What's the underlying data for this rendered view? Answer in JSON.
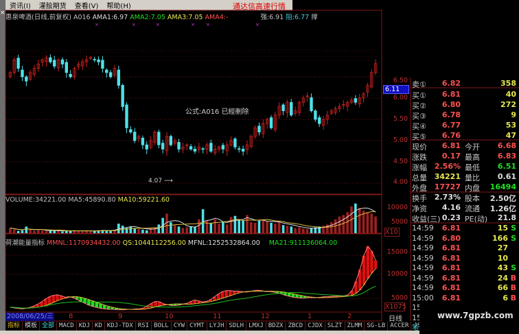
{
  "menu": {
    "items": [
      "资讯(I)",
      "灌脍期货",
      "查看(V)",
      "帮助(H)"
    ],
    "app_title": "通达信高速行情",
    "close_glyph": "×"
  },
  "legend": {
    "stock": "惠泉啤酒(日线,前复权)",
    "formula": "A016",
    "ama1": "AMA1:6.97",
    "ama2": "AMA2:7.05",
    "ama3": "AMA3:7.05",
    "ama4": "AMA4:-",
    "strong": "强:6.91",
    "resist": "阻:6.77",
    "support": "撑"
  },
  "main": {
    "note": "公式:A016 已經刪除",
    "low_mark": "4.07 ⟶",
    "price_tag": "6.11",
    "axis": [
      "6.50",
      "6.00",
      "5.50",
      "5.00",
      "4.50",
      "4.00"
    ]
  },
  "volume": {
    "label": "VOLUME:34221.00",
    "ma5": "MA5:45890.80",
    "ma10": "MA10:59221.60",
    "axis": [
      "10000",
      "5000"
    ],
    "mult": "X10"
  },
  "indicator": {
    "name": "荷潮能量指标",
    "mmnl": "MMNL:1170934432.00",
    "qs": "QS:1044112256.00",
    "mfnl": "MFNL:1252532864.00",
    "ma21": "MA21:911136064.00",
    "axis": [
      "15000",
      "10000",
      "5000"
    ],
    "mult": "X1075"
  },
  "chart_data": {
    "type": "candlestick",
    "price_range": [
      3.8,
      7.2
    ],
    "closes": [
      6.6,
      6.9,
      6.7,
      6.5,
      6.4,
      6.6,
      6.7,
      6.8,
      6.9,
      6.95,
      6.85,
      6.75,
      6.9,
      6.8,
      6.6,
      6.5,
      6.7,
      6.8,
      6.85,
      6.9,
      6.95,
      6.9,
      6.85,
      6.7,
      6.6,
      6.5,
      6.7,
      6.3,
      5.8,
      5.3,
      5.2,
      5.0,
      5.1,
      4.9,
      4.8,
      5.0,
      5.2,
      4.9,
      4.8,
      5.1,
      4.9,
      5.0,
      4.8,
      4.85,
      4.9,
      4.8,
      4.75,
      4.85,
      4.8,
      4.9,
      4.75,
      4.8,
      4.85,
      4.8,
      4.9,
      5.0,
      4.85,
      4.8,
      4.75,
      4.9,
      5.1,
      5.3,
      5.2,
      5.4,
      5.5,
      5.3,
      5.6,
      5.8,
      5.7,
      5.9,
      5.6,
      5.7,
      5.9,
      6.0,
      6.05,
      5.7,
      5.5,
      5.4,
      5.5,
      5.6,
      5.7,
      5.75,
      5.8,
      5.85,
      5.9,
      5.95,
      5.9,
      6.0,
      6.1,
      6.3,
      6.6,
      6.81
    ],
    "volumes": [
      3000,
      2500,
      2000,
      2200,
      3500,
      2400,
      2000,
      2300,
      2100,
      1900,
      2200,
      2000,
      2100,
      1800,
      2000,
      1900,
      2200,
      2000,
      1800,
      2100,
      1900,
      2000,
      2200,
      2300,
      2100,
      2000,
      2400,
      4500,
      3800,
      3000,
      3500,
      2800,
      2600,
      2400,
      2200,
      2900,
      3200,
      4200,
      6500,
      8000,
      5000,
      4000,
      3500,
      3000,
      3200,
      3600,
      3400,
      6000,
      9500,
      5500,
      4800,
      6000,
      4500,
      5000,
      4200,
      6800,
      7200,
      6000,
      5500,
      7500,
      5000,
      4800,
      5500,
      6000,
      5200,
      4800,
      4500,
      5000,
      4000,
      3800,
      3500,
      3000,
      3200,
      2800,
      2600,
      3000,
      3200,
      3500,
      3800,
      4200,
      5000,
      6000,
      7000,
      7500,
      8500,
      10500,
      11500,
      10000,
      9000,
      8500,
      8000,
      7000
    ],
    "mmnl": [
      3000,
      2800,
      2700,
      2600,
      2700,
      2900,
      3200,
      3600,
      4100,
      4700,
      5200,
      5500,
      5600,
      5400,
      5100,
      5200,
      5000,
      4600,
      4200,
      3800,
      3400,
      3100,
      2900,
      2700,
      2600,
      2500,
      2500,
      2400,
      2400,
      2400,
      2500,
      2500,
      2600,
      2600,
      2800,
      3300,
      3800,
      4200,
      4100,
      3700,
      3500,
      3300,
      3300,
      3400,
      3600,
      3800,
      4200,
      4500,
      4300,
      4100,
      4200,
      4600,
      5200,
      5800,
      6300,
      6500,
      6500,
      6400,
      6400,
      6300,
      6200,
      6300,
      6500,
      6600,
      6500,
      6300,
      6300,
      6200,
      6000,
      5800,
      5500,
      5300,
      5100,
      5000,
      4900,
      4900,
      5000,
      5000,
      5000,
      5100,
      5200,
      5200,
      5300,
      5300,
      5400,
      5400,
      5600,
      6500,
      8500,
      11000,
      14000,
      16000,
      15000,
      13000
    ]
  },
  "datebar": {
    "date": "2008/06/25/三",
    "months": [
      "8",
      "9",
      "10",
      "11",
      "12",
      "1",
      "2"
    ],
    "period": "日线"
  },
  "tabs": [
    "指标",
    "模板",
    "全部",
    "MACD",
    "KDJ",
    "KD",
    "KDJ-TDX",
    "RSI",
    "BOLL",
    "CYW",
    "CYMT",
    "LYJH",
    "SDLH",
    "LMXJ",
    "BDZX",
    "ZBCD",
    "CJDX",
    "SLZT",
    "ZLMM",
    "SG-LB",
    "ACCER",
    "JS",
    "MFI"
  ],
  "tab_extra": "笔",
  "quote": {
    "book": [
      {
        "label": "卖①",
        "price": "6.82",
        "vol": "358"
      },
      {
        "label": "买①",
        "price": "6.81",
        "vol": "40"
      },
      {
        "label": "买②",
        "price": "6.80",
        "vol": "272"
      },
      {
        "label": "买③",
        "price": "6.78",
        "vol": "9"
      },
      {
        "label": "买④",
        "price": "6.77",
        "vol": "53"
      },
      {
        "label": "买⑤",
        "price": "6.76",
        "vol": "47"
      }
    ],
    "stats": [
      {
        "l": "现价",
        "v": "6.81",
        "l2": "今开",
        "v2": "6.68"
      },
      {
        "l": "涨跌",
        "v": "0.17",
        "l2": "最高",
        "v2": "6.83"
      },
      {
        "l": "涨幅",
        "v": "2.56%",
        "l2": "最低",
        "v2": "6.51"
      },
      {
        "l": "总量",
        "v": "34221",
        "l2": "量比",
        "v2": "0.61"
      },
      {
        "l": "外盘",
        "v": "17727",
        "l2": "内盘",
        "v2": "16494"
      }
    ],
    "fund": [
      {
        "l": "换手",
        "v": "2.73%",
        "l2": "股本",
        "v2": "2.50亿"
      },
      {
        "l": "净资",
        "v": "4.16",
        "l2": "流通",
        "v2": "1.26亿"
      },
      {
        "l": "收益(三)",
        "v": "0.23",
        "l2": "PE(动)",
        "v2": "21.8"
      }
    ],
    "ticks": [
      {
        "t": "14:59",
        "p": "6.81",
        "v": "15",
        "s": "S"
      },
      {
        "t": "14:59",
        "p": "6.80",
        "v": "166",
        "s": "S"
      },
      {
        "t": "14:59",
        "p": "6.81",
        "v": "27",
        "s": ""
      },
      {
        "t": "14:59",
        "p": "6.81",
        "v": "10",
        "s": ""
      },
      {
        "t": "14:59",
        "p": "6.81",
        "v": "43",
        "s": "S"
      },
      {
        "t": "14:59",
        "p": "6.81",
        "v": "24",
        "s": "B"
      },
      {
        "t": "14:59",
        "p": "6.81",
        "v": "66",
        "s": "B"
      },
      {
        "t": "15:00",
        "p": "6.81",
        "v": "6",
        "s": "B"
      },
      {
        "t": "15",
        "p": "",
        "v": "",
        "s": ""
      },
      {
        "t": "15",
        "p": "",
        "v": "",
        "s": ""
      }
    ]
  },
  "watermark": "www.7gpzb.com",
  "colors": {
    "up": "#d02020",
    "down": "#50e0e8",
    "grid": "#801818",
    "ma5": "#e0e0e0",
    "ma10": "#e0c040",
    "ma21": "#20c020"
  }
}
